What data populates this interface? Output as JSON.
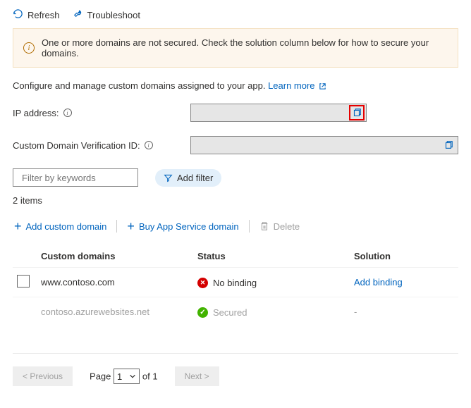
{
  "toolbar": {
    "refresh_label": "Refresh",
    "troubleshoot_label": "Troubleshoot"
  },
  "alert": {
    "message": "One or more domains are not secured. Check the solution column below for how to secure your domains."
  },
  "intro": {
    "text": "Configure and manage custom domains assigned to your app. ",
    "link_text": "Learn more"
  },
  "fields": {
    "ip_label": "IP address:",
    "ip_value": "",
    "cdv_label": "Custom Domain Verification ID:",
    "cdv_value": ""
  },
  "filter": {
    "placeholder": "Filter by keywords",
    "add_filter_label": "Add filter"
  },
  "items_count_label": "2 items",
  "domain_toolbar": {
    "add_custom_domain": "Add custom domain",
    "buy_app_service_domain": "Buy App Service domain",
    "delete_label": "Delete"
  },
  "columns": {
    "domains": "Custom domains",
    "status": "Status",
    "solution": "Solution"
  },
  "rows": [
    {
      "domain": "www.contoso.com",
      "status_icon": "error",
      "status_text": "No binding",
      "solution_text": "Add binding",
      "solution_is_link": true,
      "selectable": true
    },
    {
      "domain": "contoso.azurewebsites.net",
      "status_icon": "success",
      "status_text": "Secured",
      "solution_text": "-",
      "solution_is_link": false,
      "selectable": false
    }
  ],
  "pager": {
    "previous": "< Previous",
    "page_label": "Page",
    "current": "1",
    "of_label": "of 1",
    "next": "Next >"
  }
}
